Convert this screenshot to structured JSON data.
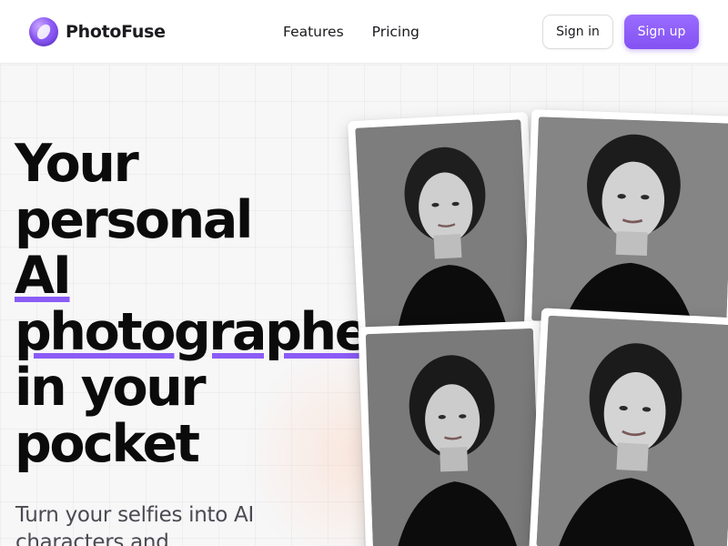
{
  "brand": {
    "name": "PhotoFuse",
    "logo_icon": "photofuse-logo-icon",
    "accent_color": "#8b5cf6"
  },
  "nav": {
    "items": [
      {
        "label": "Features"
      },
      {
        "label": "Pricing"
      }
    ]
  },
  "auth": {
    "signin_label": "Sign in",
    "signup_label": "Sign up"
  },
  "hero": {
    "headline_lines": [
      {
        "text": "Your"
      },
      {
        "text": "personal"
      },
      {
        "text": "AI"
      },
      {
        "text": "photographer"
      },
      {
        "text": "in your"
      },
      {
        "text": "pocket"
      }
    ],
    "subtitle": "Turn your selfies into AI characters and"
  },
  "photos": [
    {
      "name": "portrait-photo-1"
    },
    {
      "name": "portrait-photo-2"
    },
    {
      "name": "portrait-photo-3"
    },
    {
      "name": "portrait-photo-4"
    }
  ]
}
